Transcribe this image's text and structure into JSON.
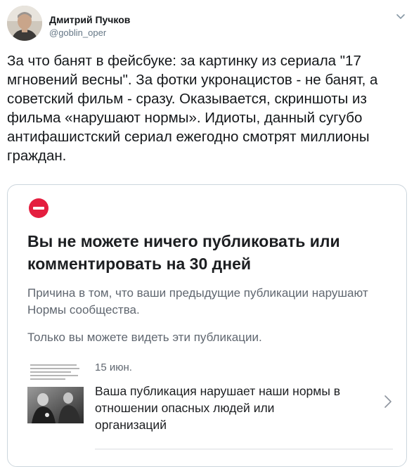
{
  "author": {
    "name": "Дмитрий Пучков",
    "handle": "@goblin_oper"
  },
  "tweet": {
    "text": "За что банят в фейсбуке: за картинку из сериала \"17 мгновений весны\". За фотки укронацистов - не банят, а советский фильм - сразу. Оказывается, скриншоты из фильма «нарушают нормы». Идиоты, данный сугубо антифашистский сериал ежегодно смотрят миллионы граждан."
  },
  "card": {
    "title": "Вы не можете ничего публиковать или комментировать на 30 дней",
    "reason": "Причина в том, что ваши предыдущие публикации нарушают Нормы сообщества.",
    "only_you": "Только вы можете видеть эти публикации.",
    "post": {
      "date": "15 июн.",
      "text": "Ваша публикация нарушает наши нормы в отношении опасных людей или организаций"
    }
  },
  "colors": {
    "stop_red": "#e41e3f",
    "handle_gray": "#657786",
    "border": "#ccd6dd"
  },
  "icons": [
    "more-chevron-down-icon",
    "stop-icon",
    "chevron-right-icon"
  ]
}
